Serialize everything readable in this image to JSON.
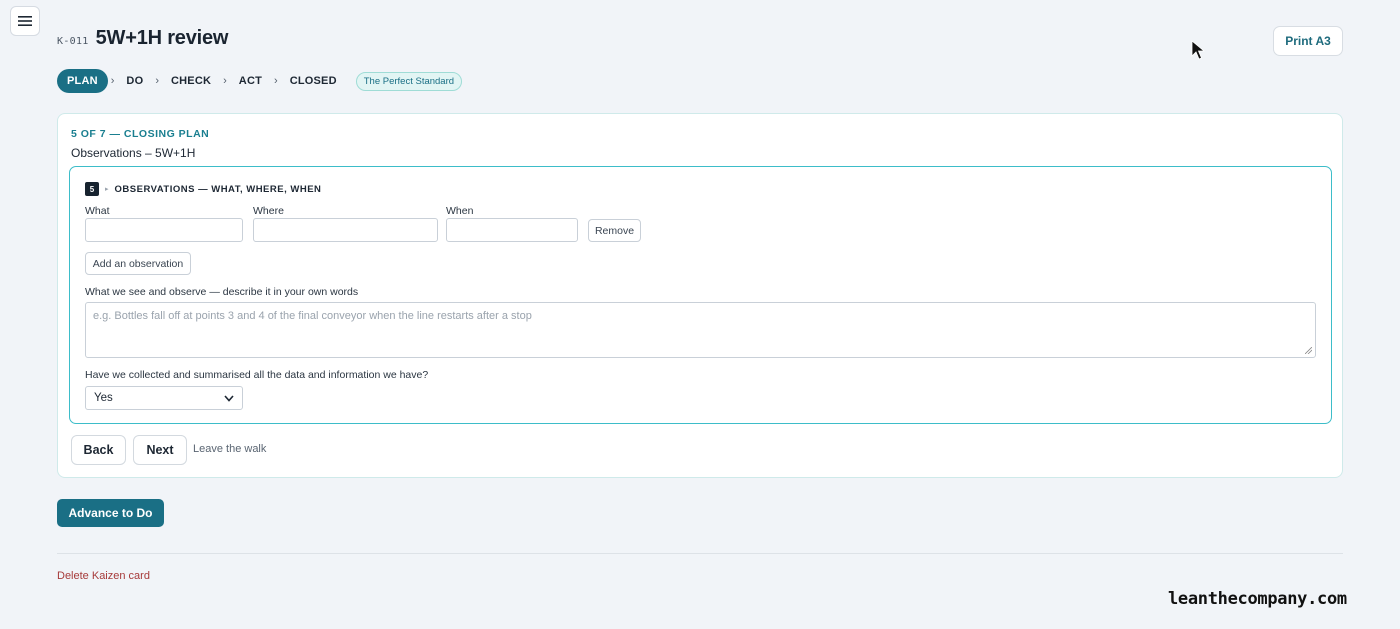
{
  "header": {
    "card_id": "K-011",
    "title": "5W+1H review",
    "print_label": "Print A3"
  },
  "stages": {
    "items": [
      {
        "label": "PLAN",
        "active": true
      },
      {
        "label": "DO",
        "active": false
      },
      {
        "label": "CHECK",
        "active": false
      },
      {
        "label": "ACT",
        "active": false
      },
      {
        "label": "CLOSED",
        "active": false
      }
    ],
    "separator": "›",
    "tag": "The Perfect Standard"
  },
  "step": {
    "label": "5 OF 7 — CLOSING PLAN",
    "subtitle": "Observations – 5W+1H"
  },
  "section": {
    "number": "5",
    "caret": "▸",
    "title": "OBSERVATIONS — WHAT, WHERE, WHEN",
    "fields": {
      "what_label": "What",
      "where_label": "Where",
      "when_label": "When",
      "what_value": "",
      "where_value": "",
      "when_value": ""
    },
    "remove_label": "Remove",
    "add_label": "Add an observation",
    "describe_label": "What we see and observe — describe it in your own words",
    "describe_placeholder": "e.g. Bottles fall off at points 3 and 4 of the final conveyor when the line restarts after a stop",
    "question_label": "Have we collected and summarised all the data and information we have?",
    "question_value": "Yes"
  },
  "nav": {
    "back_label": "Back",
    "next_label": "Next",
    "leave_label": "Leave the walk"
  },
  "footer": {
    "advance_label": "Advance to Do",
    "delete_label": "Delete Kaizen card"
  },
  "watermark": "leanthecompany.com",
  "colors": {
    "accent": "#1a6f85",
    "accent_light": "#3dbdc9",
    "danger": "#a63a3a",
    "background": "#f1f4f8"
  },
  "icons": {
    "menu": "hamburger-icon",
    "select": "chevron-down-icon",
    "cursor": "mouse-pointer-icon"
  }
}
